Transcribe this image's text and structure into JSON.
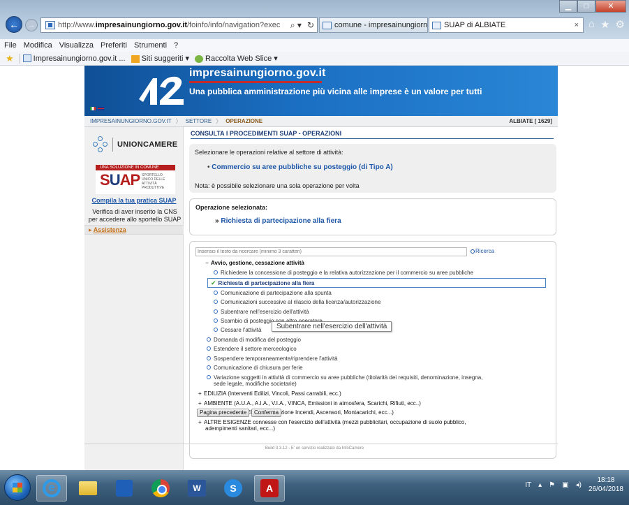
{
  "browser": {
    "url_prefix": "http://www.",
    "url_domain": "impresainungiorno.gov.it",
    "url_path": "/foinfo/info/navigation?exec",
    "tabs": [
      {
        "label": "comune - impresainungiorno.g..."
      },
      {
        "label": "SUAP di ALBIATE",
        "close": "×"
      }
    ],
    "menu": [
      "File",
      "Modifica",
      "Visualizza",
      "Preferiti",
      "Strumenti",
      "?"
    ],
    "favorites": [
      {
        "label": "Impresainungiorno.gov.it ..."
      },
      {
        "label": "Siti suggeriti ▾"
      },
      {
        "label": "Raccolta Web Slice ▾"
      }
    ]
  },
  "site": {
    "title": "impresainungiorno.gov.it",
    "subtitle": "Una pubblica amministrazione più vicina alle imprese è un valore per tutti"
  },
  "breadcrumb": {
    "home": "IMPRESAINUNGIORNO.GOV.IT",
    "sector": "SETTORE",
    "current": "OPERAZIONE",
    "comune": "ALBIATE [ 1629]"
  },
  "sidebar": {
    "unioncamere": "UNIONCAMERE",
    "suap_strip": "UNA SOLUZIONE IN COMUNE",
    "suap_word_s": "S",
    "suap_word_u": "U",
    "suap_word_ap": "AP",
    "suap_small": "SPORTELLO UNICO DELLE ATTIVITÀ PRODUTTIVE",
    "compila_link": "Compila la tua pratica SUAP",
    "note": "Verifica di aver inserito la CNS per accedere allo sportello SUAP",
    "assistenza": "Assistenza"
  },
  "main": {
    "title": "CONSULTA I PROCEDIMENTI SUAP - OPERAZIONI",
    "select_label": "Selezionare le operazioni relative al settore di attività:",
    "activity": "Commercio su aree pubbliche su posteggio (di Tipo A)",
    "nota": "Nota: è possibile selezionare una sola operazione per volta",
    "selected_label": "Operazione selezionata:",
    "selected_value": "Richiesta di partecipazione alla fiera",
    "search_placeholder": "Inserisci il testo da ricercare (minimo 3 caratteri)",
    "search_button": "Ricerca",
    "tree": [
      {
        "label": "Avvio, gestione, cessazione attività",
        "type": "group-open"
      },
      {
        "label": "Richiedere la concessione di posteggio e la relativa autorizzazione per il commercio su aree pubbliche",
        "type": "radio"
      },
      {
        "label": "Richiesta di partecipazione alla fiera",
        "type": "checked"
      },
      {
        "label": "Comunicazione di partecipazione alla spunta",
        "type": "radio"
      },
      {
        "label": "Comunicazioni successive al rilascio della licenza/autorizzazione",
        "type": "radio"
      },
      {
        "label": "Subentrare nell'esercizio dell'attività",
        "type": "radio"
      },
      {
        "label": "Scambio di posteggio con altro operatore",
        "type": "radio"
      },
      {
        "label": "Cessare l'attività",
        "type": "radio"
      },
      {
        "label": "Domanda di modifica del posteggio",
        "type": "radio"
      },
      {
        "label": "Estendere il settore merceologico",
        "type": "radio"
      },
      {
        "label": "Sospendere temporaneamente/riprendere l'attività",
        "type": "radio"
      },
      {
        "label": "Comunicazione di chiusura per ferie",
        "type": "radio"
      },
      {
        "label": "Variazione soggetti in attività di commercio su aree pubbliche (titolarità dei requisiti, denominazione, insegna,",
        "type": "radio"
      },
      {
        "label": "sede legale, modifiche societarie)",
        "type": "cont"
      },
      {
        "label": "EDILIZIA (Interventi Edilizi, Vincoli, Passi carrabili, ecc.)",
        "type": "group-closed"
      },
      {
        "label": "AMBIENTE (A.U.A., A.I.A., V.I.A., VINCA, Emissioni in atmosfera, Scarichi, Rifiuti, ecc..)",
        "type": "group-closed"
      },
      {
        "label": "ALTRI ADEMPIMENTI (Prevenzione Incendi, Ascensori, Montacarichi, ecc...)",
        "type": "group-closed"
      },
      {
        "label": "ALTRE ESIGENZE connesse con l'esercizio dell'attività (mezzi pubblicitari, occupazione di suolo pubblico,",
        "type": "group-closed"
      },
      {
        "label": "adempimenti sanitari, ecc...)",
        "type": "cont"
      }
    ],
    "tooltip": "Subentrare nell'esercizio dell'attività",
    "btn_prev": "Pagina precedente",
    "btn_confirm": "Conferma"
  },
  "footer": "Build 3.3.12 - E' un servizio realizzato da InfoCamere",
  "taskbar": {
    "lang": "IT",
    "time": "18:18",
    "date": "26/04/2018"
  }
}
